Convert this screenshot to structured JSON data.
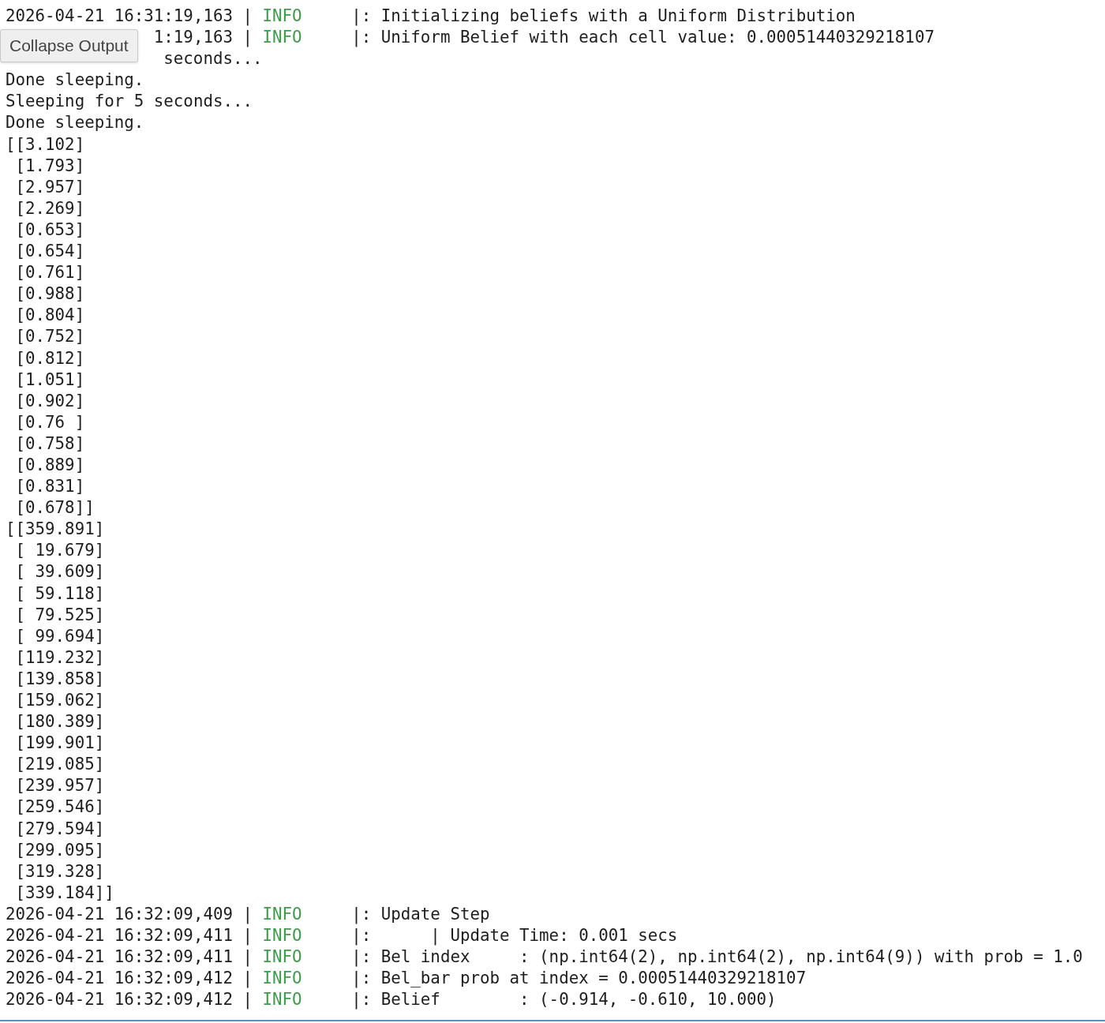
{
  "output": {
    "lines": [
      {
        "kind": "log",
        "timestamp": "2026-04-21 16:31:19,163 |",
        "level": "INFO",
        "message": "|: Initializing beliefs with a Uniform Distribution"
      },
      {
        "kind": "log",
        "timestamp": "1:19,163 |",
        "level": "INFO",
        "message": "|: Uniform Belief with each cell value: 0.00051440329218107"
      },
      {
        "kind": "tail",
        "text": "seconds..."
      },
      {
        "kind": "text",
        "text": "Done sleeping."
      },
      {
        "kind": "text",
        "text": "Sleeping for 5 seconds..."
      },
      {
        "kind": "text",
        "text": "Done sleeping."
      },
      {
        "kind": "text",
        "text": "[[3.102]"
      },
      {
        "kind": "text",
        "text": " [1.793]"
      },
      {
        "kind": "text",
        "text": " [2.957]"
      },
      {
        "kind": "text",
        "text": " [2.269]"
      },
      {
        "kind": "text",
        "text": " [0.653]"
      },
      {
        "kind": "text",
        "text": " [0.654]"
      },
      {
        "kind": "text",
        "text": " [0.761]"
      },
      {
        "kind": "text",
        "text": " [0.988]"
      },
      {
        "kind": "text",
        "text": " [0.804]"
      },
      {
        "kind": "text",
        "text": " [0.752]"
      },
      {
        "kind": "text",
        "text": " [0.812]"
      },
      {
        "kind": "text",
        "text": " [1.051]"
      },
      {
        "kind": "text",
        "text": " [0.902]"
      },
      {
        "kind": "text",
        "text": " [0.76 ]"
      },
      {
        "kind": "text",
        "text": " [0.758]"
      },
      {
        "kind": "text",
        "text": " [0.889]"
      },
      {
        "kind": "text",
        "text": " [0.831]"
      },
      {
        "kind": "text",
        "text": " [0.678]]"
      },
      {
        "kind": "text",
        "text": "[[359.891]"
      },
      {
        "kind": "text",
        "text": " [ 19.679]"
      },
      {
        "kind": "text",
        "text": " [ 39.609]"
      },
      {
        "kind": "text",
        "text": " [ 59.118]"
      },
      {
        "kind": "text",
        "text": " [ 79.525]"
      },
      {
        "kind": "text",
        "text": " [ 99.694]"
      },
      {
        "kind": "text",
        "text": " [119.232]"
      },
      {
        "kind": "text",
        "text": " [139.858]"
      },
      {
        "kind": "text",
        "text": " [159.062]"
      },
      {
        "kind": "text",
        "text": " [180.389]"
      },
      {
        "kind": "text",
        "text": " [199.901]"
      },
      {
        "kind": "text",
        "text": " [219.085]"
      },
      {
        "kind": "text",
        "text": " [239.957]"
      },
      {
        "kind": "text",
        "text": " [259.546]"
      },
      {
        "kind": "text",
        "text": " [279.594]"
      },
      {
        "kind": "text",
        "text": " [299.095]"
      },
      {
        "kind": "text",
        "text": " [319.328]"
      },
      {
        "kind": "text",
        "text": " [339.184]]"
      },
      {
        "kind": "log",
        "timestamp": "2026-04-21 16:32:09,409 |",
        "level": "INFO",
        "message": "|: Update Step"
      },
      {
        "kind": "log",
        "timestamp": "2026-04-21 16:32:09,411 |",
        "level": "INFO",
        "message": "|:      | Update Time: 0.001 secs"
      },
      {
        "kind": "log",
        "timestamp": "2026-04-21 16:32:09,411 |",
        "level": "INFO",
        "message": "|: Bel index     : (np.int64(2), np.int64(2), np.int64(9)) with prob = 1.0"
      },
      {
        "kind": "log",
        "timestamp": "2026-04-21 16:32:09,412 |",
        "level": "INFO",
        "message": "|: Bel_bar prob at index = 0.00051440329218107"
      },
      {
        "kind": "log",
        "timestamp": "2026-04-21 16:32:09,412 |",
        "level": "INFO",
        "message": "|: Belief        : (-0.914, -0.610, 10.000)"
      }
    ]
  },
  "tooltip": {
    "text": "Collapse Output"
  }
}
